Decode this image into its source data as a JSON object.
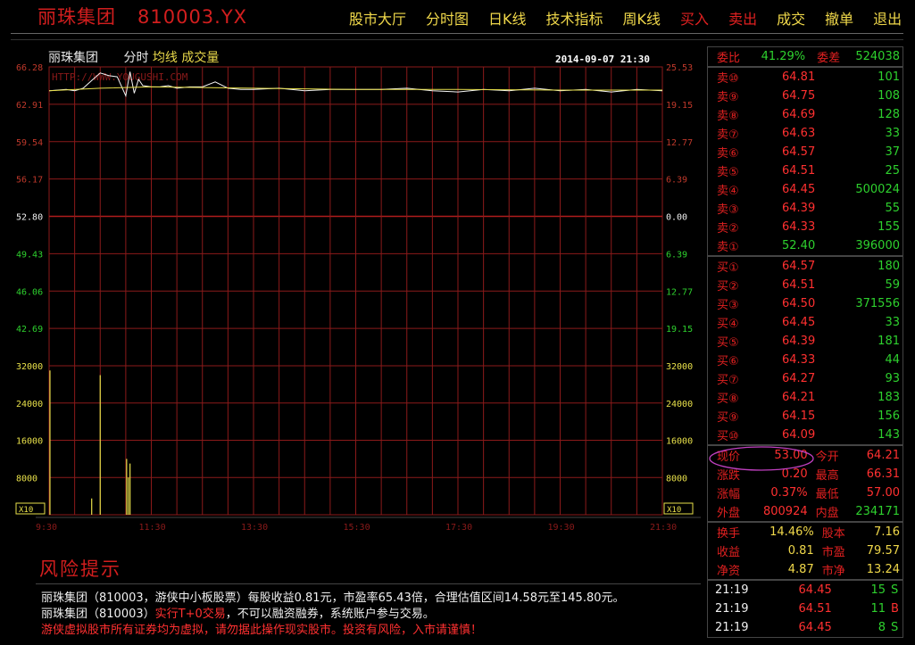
{
  "header": {
    "stock_name": "丽珠集团",
    "stock_code": "810003.YX"
  },
  "nav": [
    {
      "label": "股市大厅",
      "color": "yellow"
    },
    {
      "label": "分时图",
      "color": "yellow"
    },
    {
      "label": "日K线",
      "color": "yellow"
    },
    {
      "label": "技术指标",
      "color": "yellow"
    },
    {
      "label": "周K线",
      "color": "yellow"
    },
    {
      "label": "买入",
      "color": "red"
    },
    {
      "label": "卖出",
      "color": "red"
    },
    {
      "label": "成交",
      "color": "yellow"
    },
    {
      "label": "撤单",
      "color": "yellow"
    },
    {
      "label": "退出",
      "color": "yellow"
    }
  ],
  "chart": {
    "name": "丽珠集团",
    "mode": "分时",
    "avg_label": "均线",
    "vol_label": "成交量",
    "datetime": "2014-09-07 21:30",
    "watermark": "HTTP://WWW.YOUGUSHI.COM",
    "price_ticks_left": [
      "66.28",
      "62.91",
      "59.54",
      "56.17",
      "52.80",
      "49.43",
      "46.06",
      "42.69"
    ],
    "pct_ticks_right": [
      "25.53",
      "19.15",
      "12.77",
      "6.39",
      "0.00",
      "6.39",
      "12.77",
      "19.15"
    ],
    "vol_ticks": [
      "32000",
      "24000",
      "16000",
      "8000"
    ],
    "vol_multiplier": "X10",
    "time_ticks": [
      "9:30",
      "11:30",
      "13:30",
      "15:30",
      "17:30",
      "19:30",
      "21:30"
    ]
  },
  "chart_data": {
    "type": "line",
    "title": "",
    "xlabel": "",
    "ylabel": "",
    "ylim": [
      42.69,
      66.28
    ],
    "x_range": [
      "9:30",
      "21:30"
    ],
    "series": [
      {
        "kind": "price",
        "x": [
          "9:30",
          "9:40",
          "9:50",
          "10:00",
          "10:10",
          "10:20",
          "10:30",
          "10:40",
          "10:50",
          "11:00",
          "11:05",
          "11:10",
          "11:15",
          "11:20",
          "11:30",
          "11:40",
          "11:50",
          "12:00",
          "12:15",
          "12:30",
          "12:45",
          "13:00",
          "13:15",
          "13:30",
          "14:00",
          "14:30",
          "15:00",
          "15:30",
          "16:00",
          "16:30",
          "17:00",
          "17:30",
          "18:00",
          "18:30",
          "19:00",
          "19:30",
          "20:00",
          "20:30",
          "21:00",
          "21:30"
        ],
        "values": [
          64.4,
          64.45,
          64.5,
          64.4,
          64.6,
          65.2,
          65.8,
          65.6,
          65.5,
          64.0,
          65.9,
          64.2,
          65.3,
          64.8,
          64.7,
          64.7,
          64.8,
          64.6,
          64.7,
          64.7,
          65.1,
          64.6,
          64.5,
          64.5,
          64.6,
          64.4,
          64.5,
          64.5,
          64.5,
          64.6,
          64.4,
          64.3,
          64.5,
          64.4,
          64.6,
          64.4,
          64.5,
          64.3,
          64.5,
          64.4
        ]
      },
      {
        "kind": "average",
        "x": [
          "9:30",
          "10:30",
          "11:30",
          "13:30",
          "15:30",
          "17:30",
          "19:30",
          "21:30"
        ],
        "values": [
          64.4,
          64.6,
          64.7,
          64.6,
          64.5,
          64.5,
          64.45,
          64.45
        ]
      }
    ],
    "volume": {
      "x": [
        "9:31",
        "10:20",
        "10:30",
        "11:01",
        "11:03",
        "11:05"
      ],
      "values": [
        31000,
        3500,
        30000,
        12000,
        8000,
        11000
      ]
    }
  },
  "orderbook": {
    "commission": {
      "ratio_label": "委比",
      "ratio": "41.29%",
      "diff_label": "委差",
      "diff": "524038"
    },
    "asks": [
      {
        "label": "卖⑩",
        "price": "64.81",
        "vol": "101",
        "pcolor": "red"
      },
      {
        "label": "卖⑨",
        "price": "64.75",
        "vol": "108",
        "pcolor": "red"
      },
      {
        "label": "卖⑧",
        "price": "64.69",
        "vol": "128",
        "pcolor": "red"
      },
      {
        "label": "卖⑦",
        "price": "64.63",
        "vol": "33",
        "pcolor": "red"
      },
      {
        "label": "卖⑥",
        "price": "64.57",
        "vol": "37",
        "pcolor": "red"
      },
      {
        "label": "卖⑤",
        "price": "64.51",
        "vol": "25",
        "pcolor": "red"
      },
      {
        "label": "卖④",
        "price": "64.45",
        "vol": "500024",
        "pcolor": "red"
      },
      {
        "label": "卖③",
        "price": "64.39",
        "vol": "55",
        "pcolor": "red"
      },
      {
        "label": "卖②",
        "price": "64.33",
        "vol": "155",
        "pcolor": "red"
      },
      {
        "label": "卖①",
        "price": "52.40",
        "vol": "396000",
        "pcolor": "green"
      }
    ],
    "bids": [
      {
        "label": "买①",
        "price": "64.57",
        "vol": "180",
        "pcolor": "red"
      },
      {
        "label": "买②",
        "price": "64.51",
        "vol": "59",
        "pcolor": "red"
      },
      {
        "label": "买③",
        "price": "64.50",
        "vol": "371556",
        "pcolor": "red"
      },
      {
        "label": "买④",
        "price": "64.45",
        "vol": "33",
        "pcolor": "red"
      },
      {
        "label": "买⑤",
        "price": "64.39",
        "vol": "181",
        "pcolor": "red"
      },
      {
        "label": "买⑥",
        "price": "64.33",
        "vol": "44",
        "pcolor": "red"
      },
      {
        "label": "买⑦",
        "price": "64.27",
        "vol": "93",
        "pcolor": "red"
      },
      {
        "label": "买⑧",
        "price": "64.21",
        "vol": "183",
        "pcolor": "red"
      },
      {
        "label": "买⑨",
        "price": "64.15",
        "vol": "156",
        "pcolor": "red"
      },
      {
        "label": "买⑩",
        "price": "64.09",
        "vol": "143",
        "pcolor": "red"
      }
    ]
  },
  "quote": [
    {
      "l1": "现价",
      "v1": "53.00",
      "c1": "red",
      "l2": "今开",
      "v2": "64.21",
      "c2": "red"
    },
    {
      "l1": "涨跌",
      "v1": "0.20",
      "c1": "red",
      "l2": "最高",
      "v2": "66.31",
      "c2": "red"
    },
    {
      "l1": "涨幅",
      "v1": "0.37%",
      "c1": "red",
      "l2": "最低",
      "v2": "57.00",
      "c2": "red"
    },
    {
      "l1": "外盘",
      "v1": "800924",
      "c1": "red",
      "l2": "内盘",
      "v2": "234171",
      "c2": "green"
    }
  ],
  "stats": [
    {
      "l1": "换手",
      "v1": "14.46%",
      "l2": "股本",
      "v2": "7.16"
    },
    {
      "l1": "收益",
      "v1": "0.81",
      "l2": "市盈",
      "v2": "79.57"
    },
    {
      "l1": "净资",
      "v1": "4.87",
      "l2": "市净",
      "v2": "13.24"
    }
  ],
  "ticks": [
    {
      "time": "21:19",
      "price": "64.45",
      "vol": "15",
      "side": "S",
      "sidecolor": "green"
    },
    {
      "time": "21:19",
      "price": "64.51",
      "vol": "11",
      "side": "B",
      "sidecolor": "red"
    },
    {
      "time": "21:19",
      "price": "64.45",
      "vol": "8",
      "side": "S",
      "sidecolor": "green"
    }
  ],
  "risk": {
    "title": "风险提示",
    "line1": "丽珠集团（810003，游侠中小板股票）每股收益0.81元，市盈率65.43倍，合理估值区间14.58元至145.80元。",
    "line2_a": "丽珠集团（810003）",
    "line2_b": "实行T+0交易",
    "line2_c": "，不可以融资融券，系统账户参与交易。",
    "line3": "游侠虚拟股市所有证券均为虚拟，请勿据此操作现实股市。投资有风险，入市请谨慎！"
  }
}
